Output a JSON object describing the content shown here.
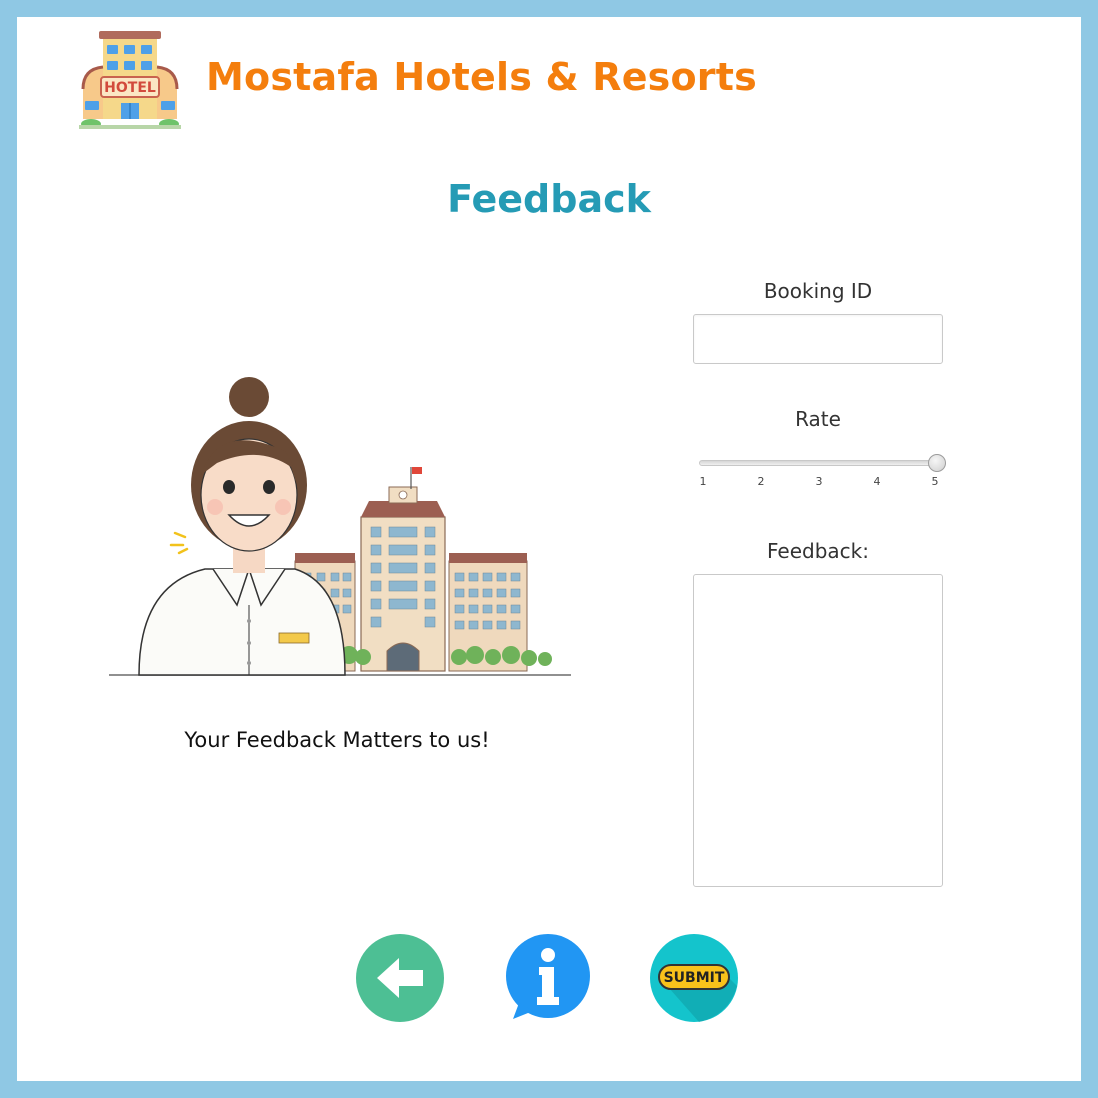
{
  "header": {
    "brand_title": "Mostafa Hotels & Resorts",
    "logo_sign_text": "HOTEL"
  },
  "page_title": "Feedback",
  "illustration": {
    "tagline": "Your Feedback Matters to us!"
  },
  "form": {
    "booking_id": {
      "label": "Booking ID",
      "value": ""
    },
    "rate": {
      "label": "Rate",
      "min": 1,
      "max": 5,
      "value": 5,
      "ticks": [
        "1",
        "2",
        "3",
        "4",
        "5"
      ]
    },
    "feedback": {
      "label": "Feedback:",
      "value": ""
    }
  },
  "buttons": {
    "back": {
      "icon": "arrow-left-icon",
      "color": "#4dbf94"
    },
    "info": {
      "icon": "info-icon",
      "color": "#2196f3"
    },
    "submit": {
      "label": "SUBMIT",
      "color": "#14c4cc",
      "badge_color": "#f9c21b"
    }
  },
  "colors": {
    "frame": "#8fc8e4",
    "brand": "#f47e0d",
    "title": "#259bb5"
  }
}
